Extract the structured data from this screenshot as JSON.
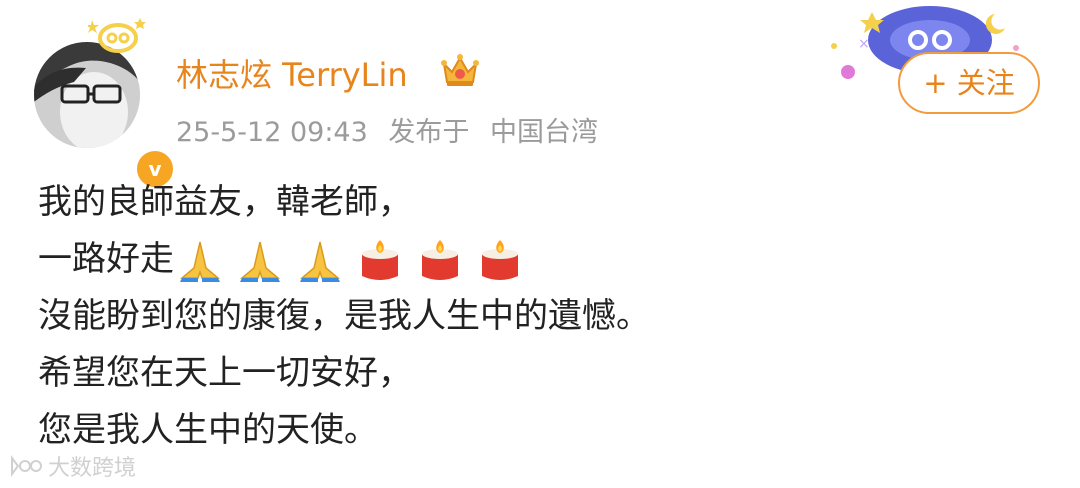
{
  "post": {
    "author": {
      "name": "林志炫 TerryLin",
      "verified_mark": "v"
    },
    "meta": {
      "date": "25-5-12 09:43",
      "published_at_label": "发布于",
      "location": "中国台湾"
    },
    "follow_label": "+ 关注",
    "lines": [
      "我的良師益友，韓老師，",
      "一路好走",
      "沒能盼到您的康復，是我人生中的遺憾。",
      "希望您在天上一切安好，",
      "您是我人生中的天使。"
    ],
    "emojis": [
      "folded-hands-icon",
      "folded-hands-icon",
      "folded-hands-icon",
      "candle-icon",
      "candle-icon",
      "candle-icon"
    ],
    "watermark": "大数跨境"
  },
  "colors": {
    "accent": "#e8841c",
    "meta_text": "#9b9b9b",
    "body_text": "#222222",
    "follow_border": "#f29b3c"
  }
}
